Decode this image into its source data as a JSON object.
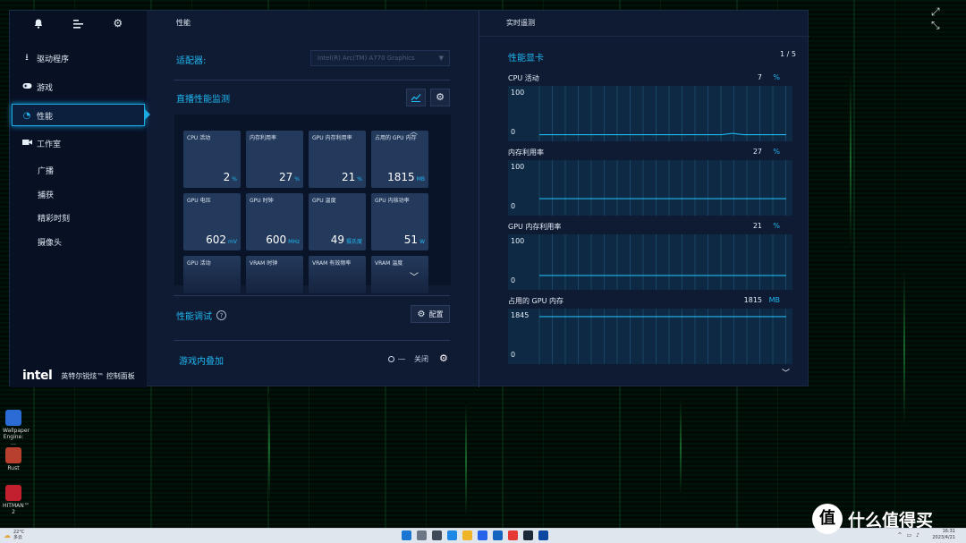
{
  "sidebar": {
    "items": [
      {
        "label": "驱动程序",
        "icon": "download-icon"
      },
      {
        "label": "游戏",
        "icon": "gamepad-icon"
      },
      {
        "label": "性能",
        "icon": "gauge-icon"
      },
      {
        "label": "工作室",
        "icon": "camera-icon"
      }
    ],
    "sub_items": [
      "广播",
      "捕获",
      "精彩时刻",
      "摄像头"
    ],
    "brand_logo": "intel",
    "brand_name": "英特尔锐炫™ 控制面板"
  },
  "main": {
    "header": "性能",
    "adapter_label": "适配器:",
    "adapter_value": "Intel(R) Arc(TM) A770 Graphics",
    "live_title": "直播性能监测",
    "tiles": [
      {
        "label": "CPU 活动",
        "value": "2",
        "unit": "%"
      },
      {
        "label": "内存利用率",
        "value": "27",
        "unit": "%"
      },
      {
        "label": "GPU 内存利用率",
        "value": "21",
        "unit": "%"
      },
      {
        "label": "占用的 GPU 内存",
        "value": "1815",
        "unit": "MB"
      },
      {
        "label": "GPU 电压",
        "value": "602",
        "unit": "mV"
      },
      {
        "label": "GPU 时钟",
        "value": "600",
        "unit": "MHz"
      },
      {
        "label": "GPU 温度",
        "value": "49",
        "unit": "摄氏度"
      },
      {
        "label": "GPU 内核功率",
        "value": "51",
        "unit": "W"
      },
      {
        "label": "GPU 活动",
        "value": "",
        "unit": ""
      },
      {
        "label": "VRAM 时钟",
        "value": "",
        "unit": ""
      },
      {
        "label": "VRAM 有效频率",
        "value": "",
        "unit": ""
      },
      {
        "label": "VRAM 温度",
        "value": "",
        "unit": ""
      }
    ],
    "tune_title": "性能调试",
    "config_label": "配置",
    "overlay_title": "游戏内叠加",
    "overlay_state": "关闭"
  },
  "realtime": {
    "header": "实时遥测",
    "gpu_title": "性能显卡",
    "pager": "1 / 5",
    "metrics": [
      {
        "label": "CPU 活动",
        "value": "7",
        "unit": "%",
        "ymax": "100",
        "ymin": "0",
        "level": 0.03
      },
      {
        "label": "内存利用率",
        "value": "27",
        "unit": "%",
        "ymax": "100",
        "ymin": "0",
        "level": 0.27
      },
      {
        "label": "GPU 内存利用率",
        "value": "21",
        "unit": "%",
        "ymax": "100",
        "ymin": "0",
        "level": 0.21
      },
      {
        "label": "占用的 GPU 内存",
        "value": "1815",
        "unit": "MB",
        "ymax": "1845",
        "ymin": "0",
        "level": 0.98
      }
    ]
  },
  "desktop_icons": [
    {
      "label": "",
      "color": "#2a6fb0"
    },
    {
      "label": "",
      "color": "#d0342c"
    },
    {
      "label": "Wallpaper Engine: ...",
      "color": "#2b6bd6"
    },
    {
      "label": "Rust",
      "color": "#b7412e"
    },
    {
      "label": "HITMAN™ 2",
      "color": "#c21f2f"
    }
  ],
  "taskbar": {
    "weather_temp": "22°C",
    "weather_desc": "多云",
    "clock_time": "16:31",
    "clock_date": "2023/4/21"
  },
  "watermark": {
    "symbol": "值",
    "text": "什么值得买"
  },
  "colors": {
    "accent": "#1fb7ef",
    "window_bg": "#0f1a33",
    "sidebar_bg": "#081024",
    "tile_bg": "#243a5c"
  }
}
